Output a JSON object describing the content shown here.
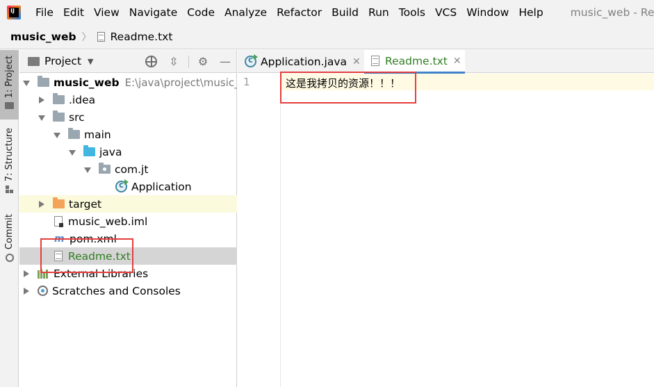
{
  "menubar": {
    "items": [
      "File",
      "Edit",
      "View",
      "Navigate",
      "Code",
      "Analyze",
      "Refactor",
      "Build",
      "Run",
      "Tools",
      "VCS",
      "Window",
      "Help"
    ],
    "window_title": "music_web - Read"
  },
  "breadcrumb": {
    "project": "music_web",
    "file": "Readme.txt"
  },
  "toolstrip": {
    "project": "1: Project",
    "structure": "7: Structure",
    "commit": "Commit"
  },
  "project_panel": {
    "title": "Project",
    "tree": [
      {
        "label": "music_web",
        "path": "E:\\java\\project\\music_we"
      },
      {
        "label": ".idea"
      },
      {
        "label": "src"
      },
      {
        "label": "main"
      },
      {
        "label": "java"
      },
      {
        "label": "com.jt"
      },
      {
        "label": "Application"
      },
      {
        "label": "target"
      },
      {
        "label": "music_web.iml"
      },
      {
        "label": "pom.xml"
      },
      {
        "label": "Readme.txt"
      },
      {
        "label": "External Libraries"
      },
      {
        "label": "Scratches and Consoles"
      }
    ]
  },
  "editor": {
    "tabs": [
      {
        "label": "Application.java",
        "active": false
      },
      {
        "label": "Readme.txt",
        "active": true
      }
    ],
    "line_number": "1",
    "content": "这是我拷贝的资源！！！"
  },
  "colors": {
    "accent_tab_underline": "#4083c9",
    "annotation_red": "#e53d3d",
    "modified_green": "#2f7d22"
  }
}
